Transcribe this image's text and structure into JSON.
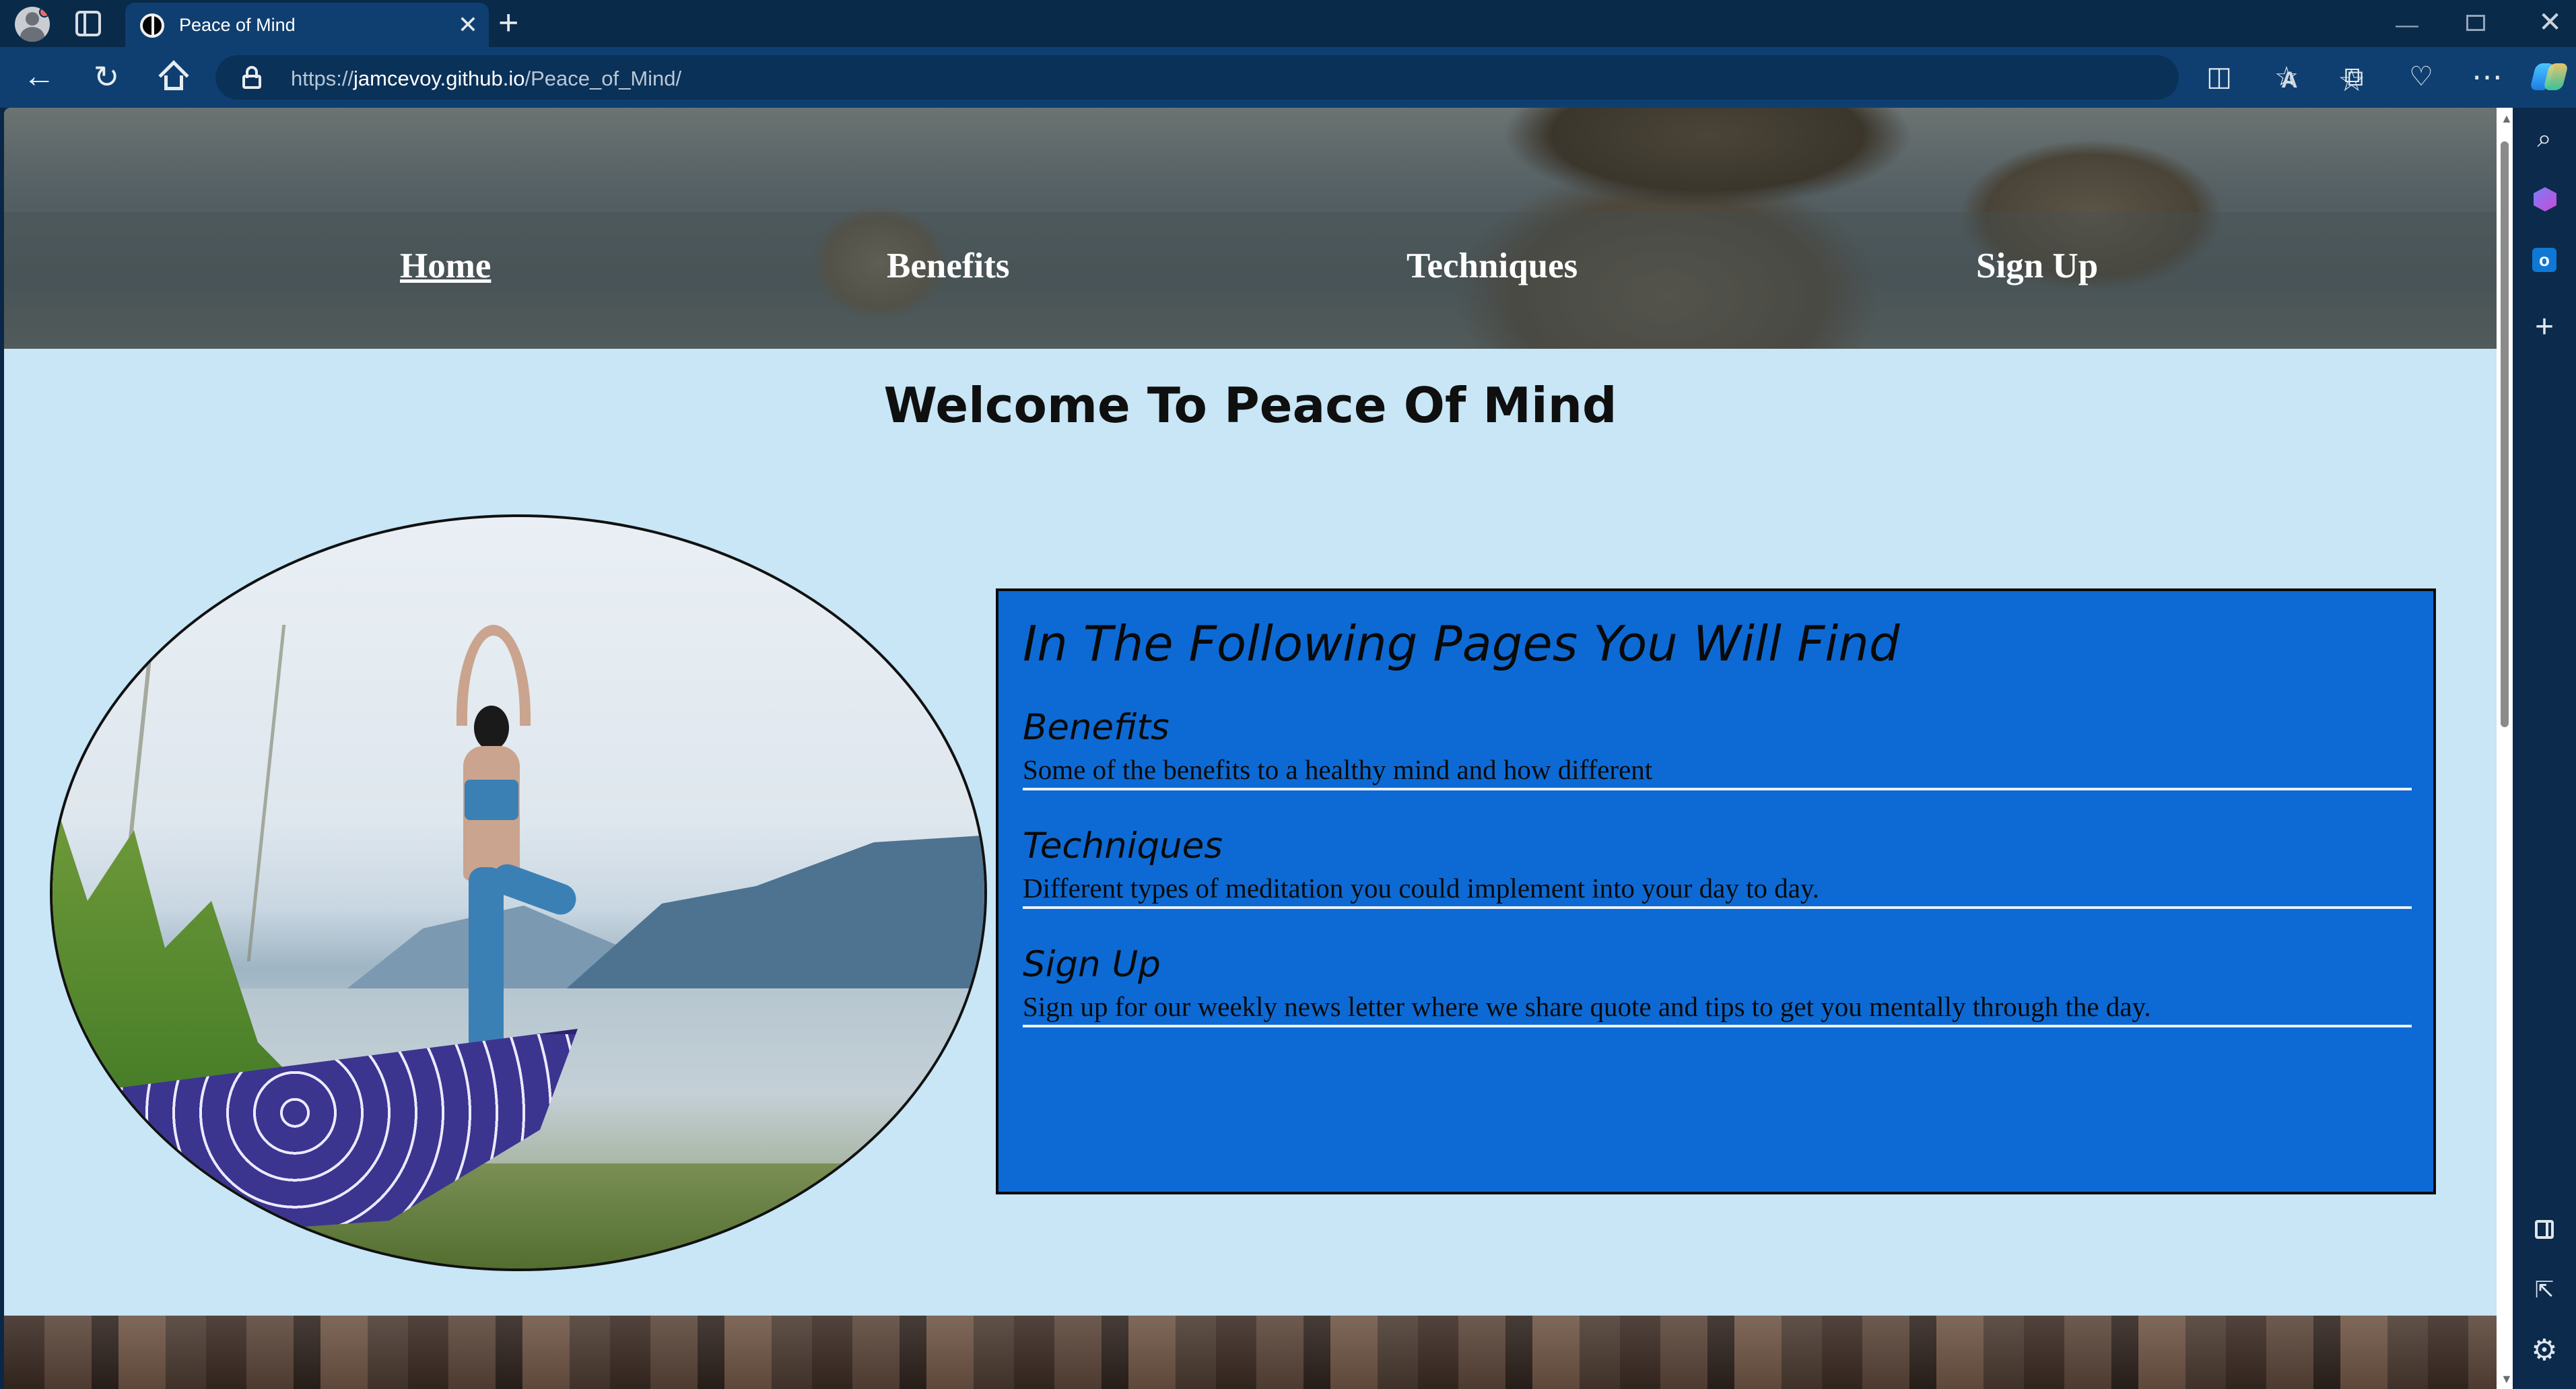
{
  "browser": {
    "tab_title": "Peace of Mind",
    "tab_close": "✕",
    "new_tab": "+",
    "url_scheme": "https://",
    "url_host": "jamcevoy.github.io",
    "url_path": "/Peace_of_Mind/",
    "read_aloud": "A",
    "favorite_star": "☆",
    "window_min": "—",
    "window_close": "✕"
  },
  "icons": {
    "back": "←",
    "reload": "↻",
    "split_screen": "◫",
    "favorites_list": "☆",
    "collections": "⧉",
    "browser_essentials": "♡",
    "more": "⋯",
    "search": "⌕",
    "add": "+",
    "popout": "⇱",
    "settings": "⚙",
    "outlook": "o"
  },
  "site": {
    "nav": {
      "home": "Home",
      "benefits": "Benefits",
      "techniques": "Techniques",
      "signup": "Sign Up"
    },
    "welcome": "Welcome To Peace Of Mind",
    "info": {
      "title": "In The Following Pages You Will Find",
      "items": [
        {
          "heading": "Benefits",
          "text": "Some of the benefits to a healthy mind and how different"
        },
        {
          "heading": "Techniques",
          "text": "Different types of meditation you could implement into your day to day."
        },
        {
          "heading": "Sign Up",
          "text": "Sign up for our weekly news letter where we share quote and tips to get you mentally through the day."
        }
      ]
    }
  },
  "colors": {
    "page_background": "#c8e6f5",
    "info_box": "#0d6ad4",
    "browser_frame": "#0f3f70"
  }
}
